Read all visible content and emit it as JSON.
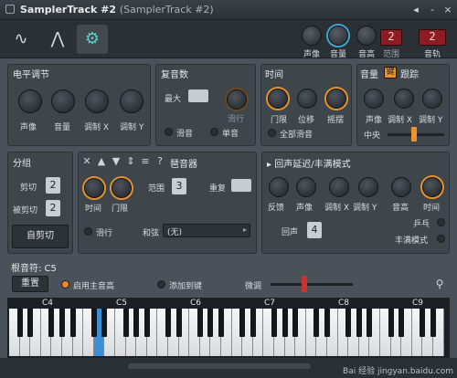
{
  "window": {
    "title": "SamplerTrack #2",
    "subtitle": "(SamplerTrack #2)",
    "menu_icon": "arrow-left-icon",
    "minimize": "-",
    "close": "×"
  },
  "topbar": {
    "tabs": [
      "waveform-icon",
      "envelope-icon",
      "wrench-icon"
    ],
    "knobs": [
      {
        "label": "声像"
      },
      {
        "label": "音量"
      },
      {
        "label": "音高"
      }
    ],
    "range_label": "范围",
    "range_value": "2",
    "track_label": "音轨",
    "track_value": "2"
  },
  "level": {
    "title": "电平调节",
    "knobs": [
      "声像",
      "音量",
      "调制 X",
      "调制 Y"
    ]
  },
  "poly": {
    "title": "复音数",
    "max_label": "最大",
    "slide_label": "滑行",
    "radio_slide": "滑音",
    "radio_mono": "单音"
  },
  "time": {
    "title": "时间",
    "knobs": [
      "门限",
      "位移",
      "摇摆"
    ],
    "radio_all": "全部滑音"
  },
  "pitch": {
    "title": "音量",
    "badge": "键",
    "follow": "跟踪",
    "knobs": [
      "声像",
      "调制 X",
      "调制 Y"
    ],
    "center": "中央"
  },
  "group": {
    "title": "分组",
    "cut_label": "剪切",
    "cut_value": "2",
    "cutby_label": "被剪切",
    "cutby_value": "2",
    "auto_button": "自剪切"
  },
  "arp": {
    "title": "琶音器",
    "icons": [
      "close-icon",
      "arrow-up-icon",
      "arrow-down-icon",
      "up-down-icon",
      "list-icon"
    ],
    "help": "?",
    "knobs": [
      "时间",
      "门限"
    ],
    "range_label": "范围",
    "range_value": "3",
    "repeat_label": "重复",
    "slide_label": "滑行",
    "chord_label": "和弦",
    "chord_value": "(无)"
  },
  "echo": {
    "title": "回声延迟/丰满模式",
    "knobs": [
      "反馈",
      "声像",
      "调制 X",
      "调制 Y",
      "音高",
      "时间"
    ],
    "echo_label": "回声",
    "echo_value": "4",
    "pingpong": "乒乓",
    "fat": "丰满模式"
  },
  "root": {
    "title": "根音符: C5",
    "reset": "重置",
    "use_main": "启用主音高",
    "add_key": "添加到键",
    "fine": "微调"
  },
  "octaves": [
    "C4",
    "C5",
    "C6",
    "C7",
    "C8",
    "C9"
  ],
  "watermark": "Bai 经验 jingyan.baidu.com"
}
